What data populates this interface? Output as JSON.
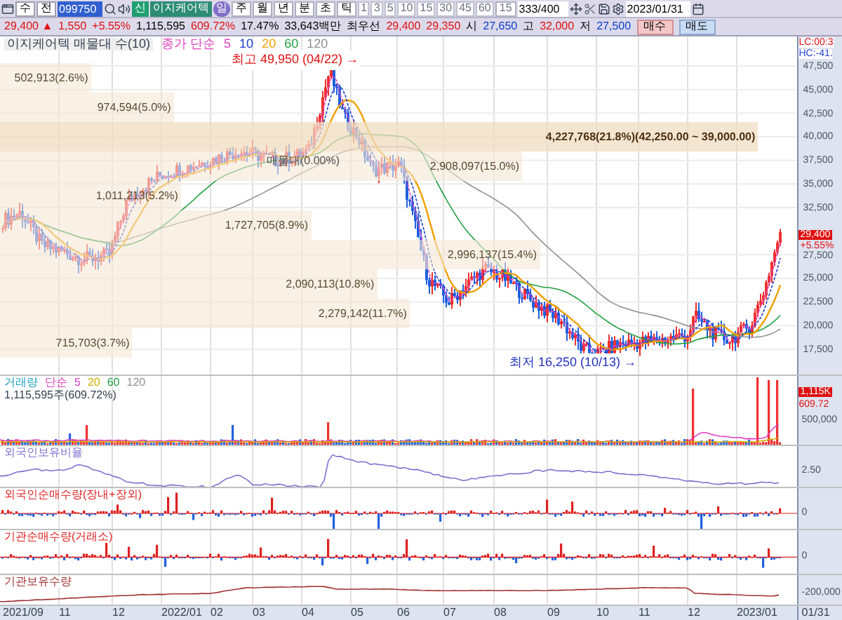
{
  "toolbar": {
    "market": "수",
    "exchange": "전",
    "code": "099750",
    "new_badge": "신",
    "name": "이지케어텍",
    "periods": [
      {
        "label": "일",
        "selected": true
      },
      {
        "label": "주",
        "selected": false
      },
      {
        "label": "월",
        "selected": false
      },
      {
        "label": "년",
        "selected": false
      },
      {
        "label": "분",
        "selected": false
      },
      {
        "label": "초",
        "selected": false
      },
      {
        "label": "틱",
        "selected": false
      }
    ],
    "intervals": [
      "1",
      "3",
      "5",
      "10",
      "15",
      "30",
      "45",
      "60"
    ],
    "interval_select": "15",
    "count": "333/400",
    "date": "2023/01/31"
  },
  "quote": [
    {
      "text": "29,400 ▲",
      "kind": "up"
    },
    {
      "text": "1,550",
      "kind": "up"
    },
    {
      "text": "+5.55%",
      "kind": "up"
    },
    {
      "text": "1,115,595",
      "kind": "plain"
    },
    {
      "text": "609.72%",
      "kind": "up"
    },
    {
      "text": "17.47%",
      "kind": "plain"
    },
    {
      "text": "33,643백만",
      "kind": "plain"
    },
    {
      "text": "최우선",
      "kind": "plain"
    },
    {
      "text": "29,400",
      "kind": "up"
    },
    {
      "text": "29,350",
      "kind": "up"
    },
    {
      "text": "시",
      "kind": "plain"
    },
    {
      "text": "27,650",
      "kind": "down"
    },
    {
      "text": "고",
      "kind": "plain"
    },
    {
      "text": "32,000",
      "kind": "up"
    },
    {
      "text": "저",
      "kind": "plain"
    },
    {
      "text": "27,500",
      "kind": "down"
    }
  ],
  "trade_buttons": [
    {
      "label": "매수",
      "kind": "buy"
    },
    {
      "label": "매도",
      "kind": "sell"
    }
  ],
  "price_panel": {
    "legend_title": "이지케어텍 매물대 수(10)",
    "ma_legend": [
      {
        "label": "종가 단순",
        "color": "#e040c0"
      },
      {
        "label": "5",
        "color": "#e040c0"
      },
      {
        "label": "10",
        "color": "#2040d0"
      },
      {
        "label": "20",
        "color": "#f0a000"
      },
      {
        "label": "60",
        "color": "#20a040"
      },
      {
        "label": "120",
        "color": "#909090"
      }
    ],
    "high_label": "최고 49,950 (04/22) →",
    "low_label": "최저 16,250 (10/13) →",
    "note": "매물대(0.00%)",
    "volume_profile": [
      {
        "text": "502,913(2.6%)",
        "level": 0.114,
        "highlight": false
      },
      {
        "text": "974,594(5.0%)",
        "level": 0.218,
        "highlight": false
      },
      {
        "text": "4,227,768(21.8%)(42,250.00 ~ 39,000.00)",
        "level": 0.951,
        "highlight": true
      },
      {
        "text": "2,908,097(15.0%)",
        "level": 0.655,
        "highlight": false
      },
      {
        "text": "1,011,213(5.2%)",
        "level": 0.227,
        "highlight": false
      },
      {
        "text": "1,727,705(8.9%)",
        "level": 0.39,
        "highlight": false
      },
      {
        "text": "2,996,137(15.4%)",
        "level": 0.677,
        "highlight": false
      },
      {
        "text": "2,090,113(10.8%)",
        "level": 0.473,
        "highlight": false
      },
      {
        "text": "2,279,142(11.7%)",
        "level": 0.514,
        "highlight": false
      },
      {
        "text": "715,703(3.7%)",
        "level": 0.166,
        "highlight": false
      }
    ],
    "axis_top": [
      "LC:00:3",
      "HC:-41."
    ],
    "yticks": [
      "47,500",
      "45,000",
      "42,500",
      "40,000",
      "37,500",
      "35,000",
      "32,500",
      "27,500",
      "25,000",
      "22,500",
      "20,000",
      "17,500"
    ],
    "last_price": "29,400",
    "last_change": "+5.55%"
  },
  "volume_panel": {
    "legend": [
      {
        "label": "거래량",
        "color": "#20a0c0"
      },
      {
        "label": "단순",
        "color": "#e040c0"
      },
      {
        "label": "5",
        "color": "#e040c0"
      },
      {
        "label": "20",
        "color": "#d0b000"
      },
      {
        "label": "60",
        "color": "#20a040"
      },
      {
        "label": "120",
        "color": "#909090"
      }
    ],
    "reading": "1,115,595주(609.72%)",
    "last": "1,115K",
    "last_pct": "609.72",
    "tick": "500,000"
  },
  "indicator_panels": [
    {
      "title": "외국인보유비율",
      "kind": "line",
      "color": "#8070d0",
      "tick": "2.50"
    },
    {
      "title": "외국인순매수량(장내+장외)",
      "kind": "bars",
      "color": "#e02020",
      "tick": "0"
    },
    {
      "title": "기관순매수량(거래소)",
      "kind": "bars",
      "color": "#e02020",
      "tick": "0"
    },
    {
      "title": "기관보유수량",
      "kind": "holding",
      "color": "#a03030",
      "tick": "-200,000"
    }
  ],
  "date_axis": [
    "2021/09",
    "11",
    "12",
    "2022/01",
    "02",
    "03",
    "04",
    "05",
    "06",
    "07",
    "08",
    "09",
    "10",
    "11",
    "12",
    "2023/01"
  ],
  "date_last": "01/31"
}
